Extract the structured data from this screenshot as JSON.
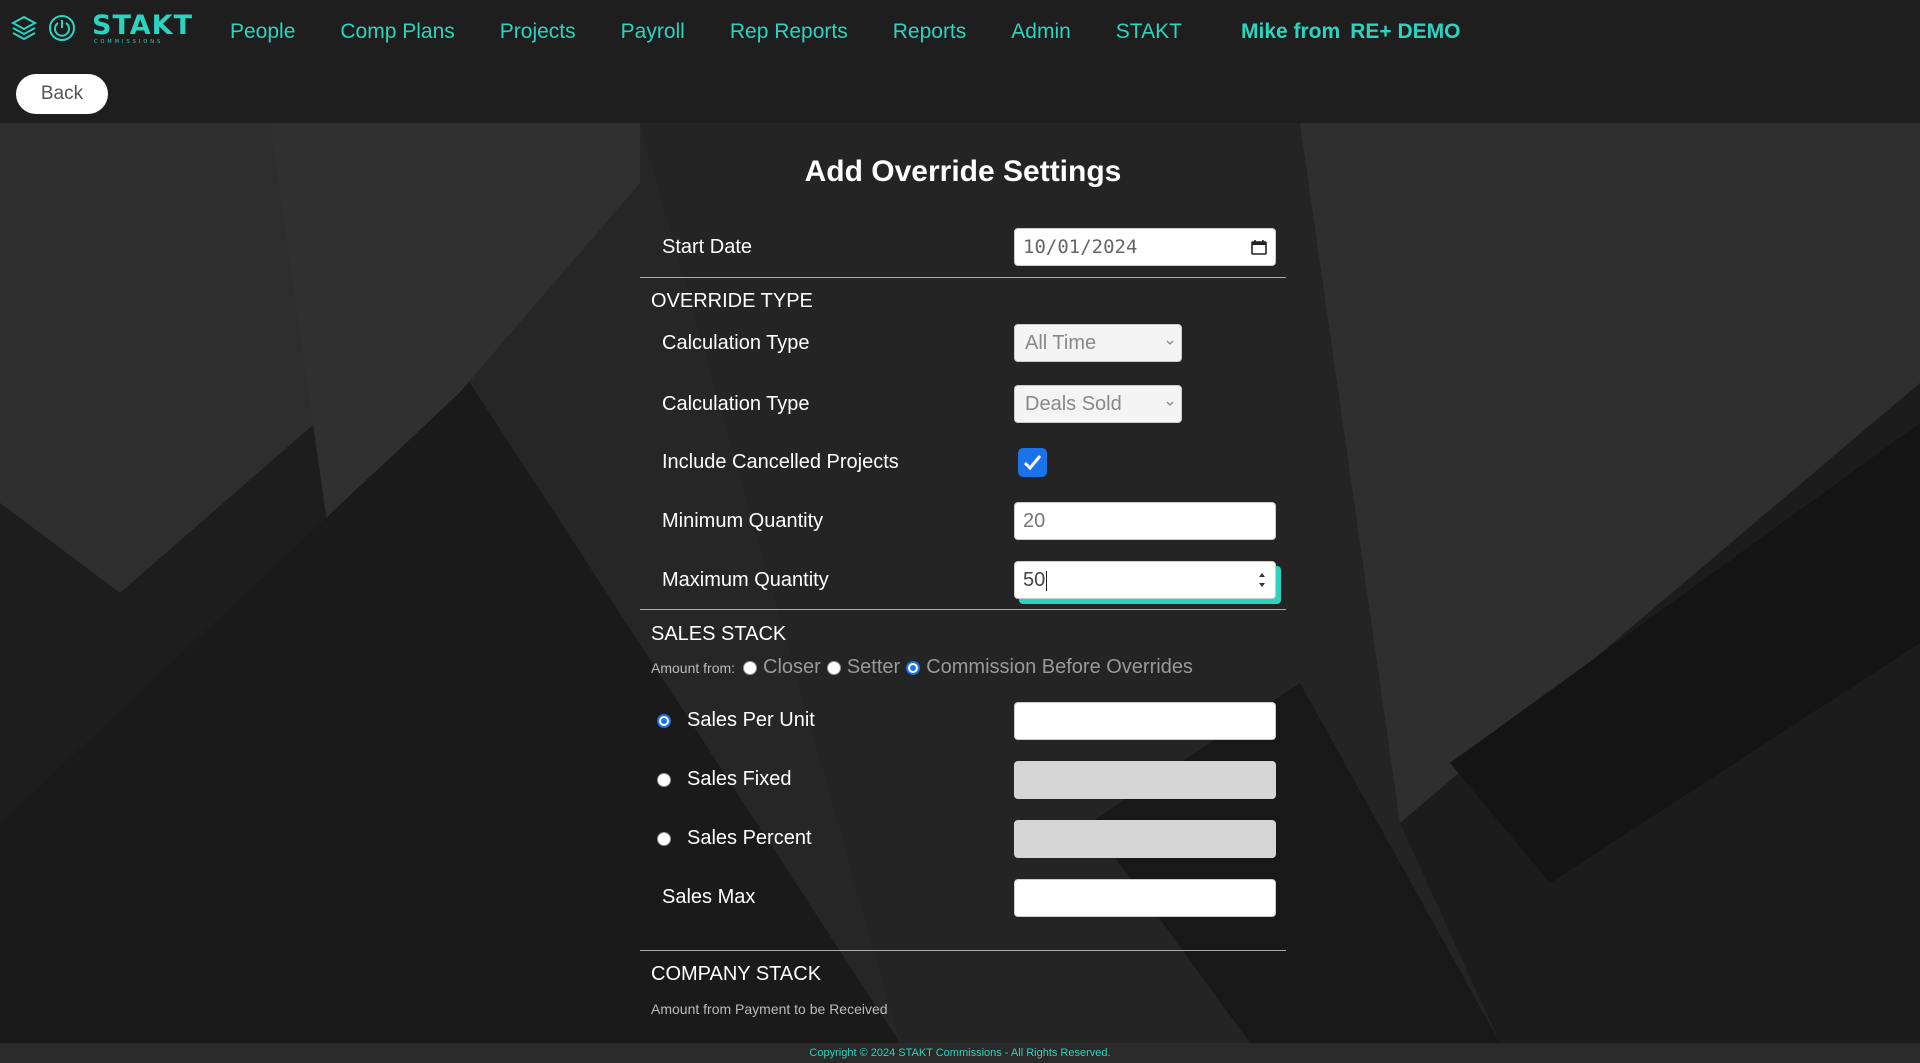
{
  "app": {
    "brand": "STAKT",
    "brand_sub": "COMMISSIONS",
    "user_name": "Mike from",
    "company": "RE+ DEMO",
    "back_label": "Back"
  },
  "nav": {
    "items": [
      {
        "label": "People"
      },
      {
        "label": "Comp Plans"
      },
      {
        "label": "Projects"
      },
      {
        "label": "Payroll"
      },
      {
        "label": "Rep Reports"
      },
      {
        "label": "Reports"
      },
      {
        "label": "Admin"
      },
      {
        "label": "STAKT"
      }
    ]
  },
  "form": {
    "title": "Add Override Settings",
    "start_date_label": "Start Date",
    "start_date_value": "10/01/2024",
    "override_type_heading": "OVERRIDE TYPE",
    "calc_type_label_1": "Calculation Type",
    "calc_type_value_1": "All Time",
    "calc_type_label_2": "Calculation Type",
    "calc_type_value_2": "Deals Sold",
    "include_cancelled_label": "Include Cancelled Projects",
    "include_cancelled_checked": true,
    "min_qty_label": "Minimum Quantity",
    "min_qty_value": "20",
    "max_qty_label": "Maximum Quantity",
    "max_qty_value": "50",
    "sales_stack_heading": "SALES STACK",
    "amount_from_label": "Amount from:",
    "amount_from_options": [
      "Closer",
      "Setter",
      "Commission Before Overrides"
    ],
    "amount_from_selected": "Commission Before Overrides",
    "sales_per_unit_label": "Sales Per Unit",
    "sales_fixed_label": "Sales Fixed",
    "sales_percent_label": "Sales Percent",
    "sales_max_label": "Sales Max",
    "sales_selected": "Sales Per Unit",
    "company_stack_heading": "COMPANY STACK",
    "company_note": "Amount from Payment to be Received"
  },
  "footer": {
    "text": "Copyright © 2024 STAKT Commissions - All Rights Reserved."
  },
  "colors": {
    "accent": "#2ed3c0",
    "checkbox": "#1a73e8",
    "background": "#262626"
  }
}
